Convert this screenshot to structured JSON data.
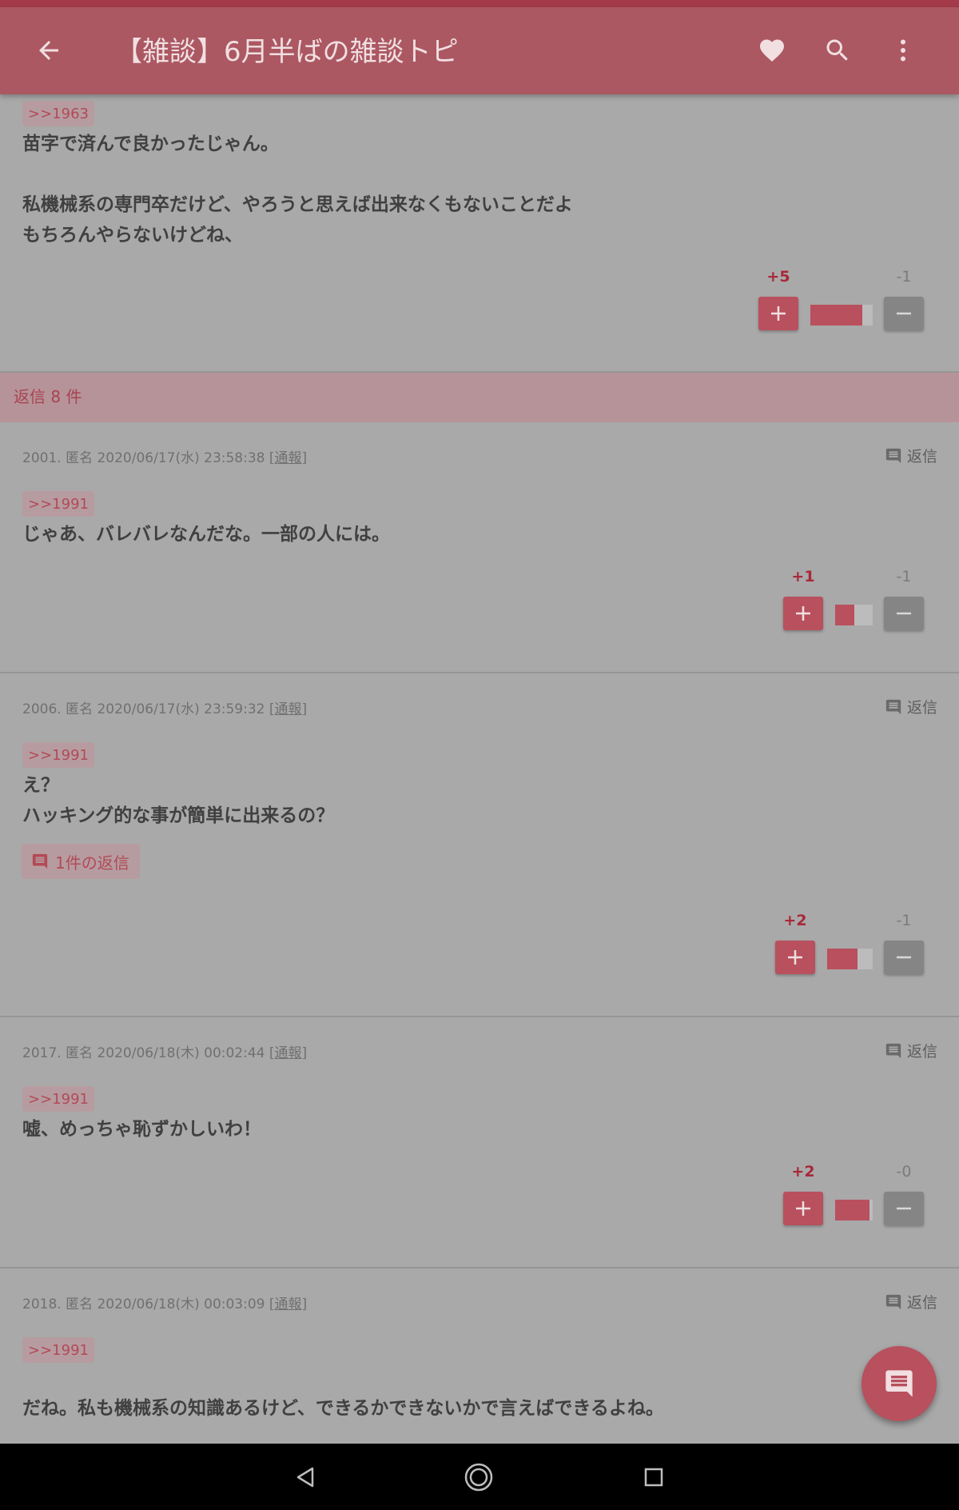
{
  "appbar": {
    "title": "【雑談】6月半ばの雑談トピ",
    "icons": [
      "back-arrow-icon",
      "heart-icon",
      "search-icon",
      "more-vert-icon"
    ]
  },
  "parent_comment": {
    "anchor": ">>1963",
    "text": "苗字で済んで良かったじゃん。\n\n私機械系の専門卒だけど、やろうと思えば出来なくもないことだよ\nもちろんやらないけどね、",
    "plus": "+5",
    "minus": "-1",
    "ratio": 0.83
  },
  "replies_header": {
    "label": "返信 8 件"
  },
  "comments": [
    {
      "meta": "2001. 匿名 2020/06/17(水) 23:58:38",
      "report": "[通報]",
      "reply_label": "返信",
      "anchor": ">>1991",
      "text": "じゃあ、バレバレなんだな。一部の人には。",
      "plus": "+1",
      "minus": "-1",
      "ratio": 0.5
    },
    {
      "meta": "2006. 匿名 2020/06/17(水) 23:59:32",
      "report": "[通報]",
      "reply_label": "返信",
      "anchor": ">>1991",
      "text": "え？\nハッキング的な事が簡単に出来るの？",
      "replies_chip": "1件の返信",
      "plus": "+2",
      "minus": "-1",
      "ratio": 0.67
    },
    {
      "meta": "2017. 匿名 2020/06/18(木) 00:02:44",
      "report": "[通報]",
      "reply_label": "返信",
      "anchor": ">>1991",
      "text": "嘘、めっちゃ恥ずかしいわ！",
      "plus": "+2",
      "minus": "-0",
      "ratio": 0.92
    },
    {
      "meta": "2018. 匿名 2020/06/18(木) 00:03:09",
      "report": "[通報]",
      "reply_label": "返信",
      "anchor": ">>1991",
      "text": "だね。私も機械系の知識あるけど、できるかできないかで言えばできるよね。"
    }
  ],
  "fab": {
    "icon": "comment-icon"
  },
  "navbar": {
    "icons": [
      "nav-back-icon",
      "nav-home-icon",
      "nav-recents-icon"
    ]
  }
}
